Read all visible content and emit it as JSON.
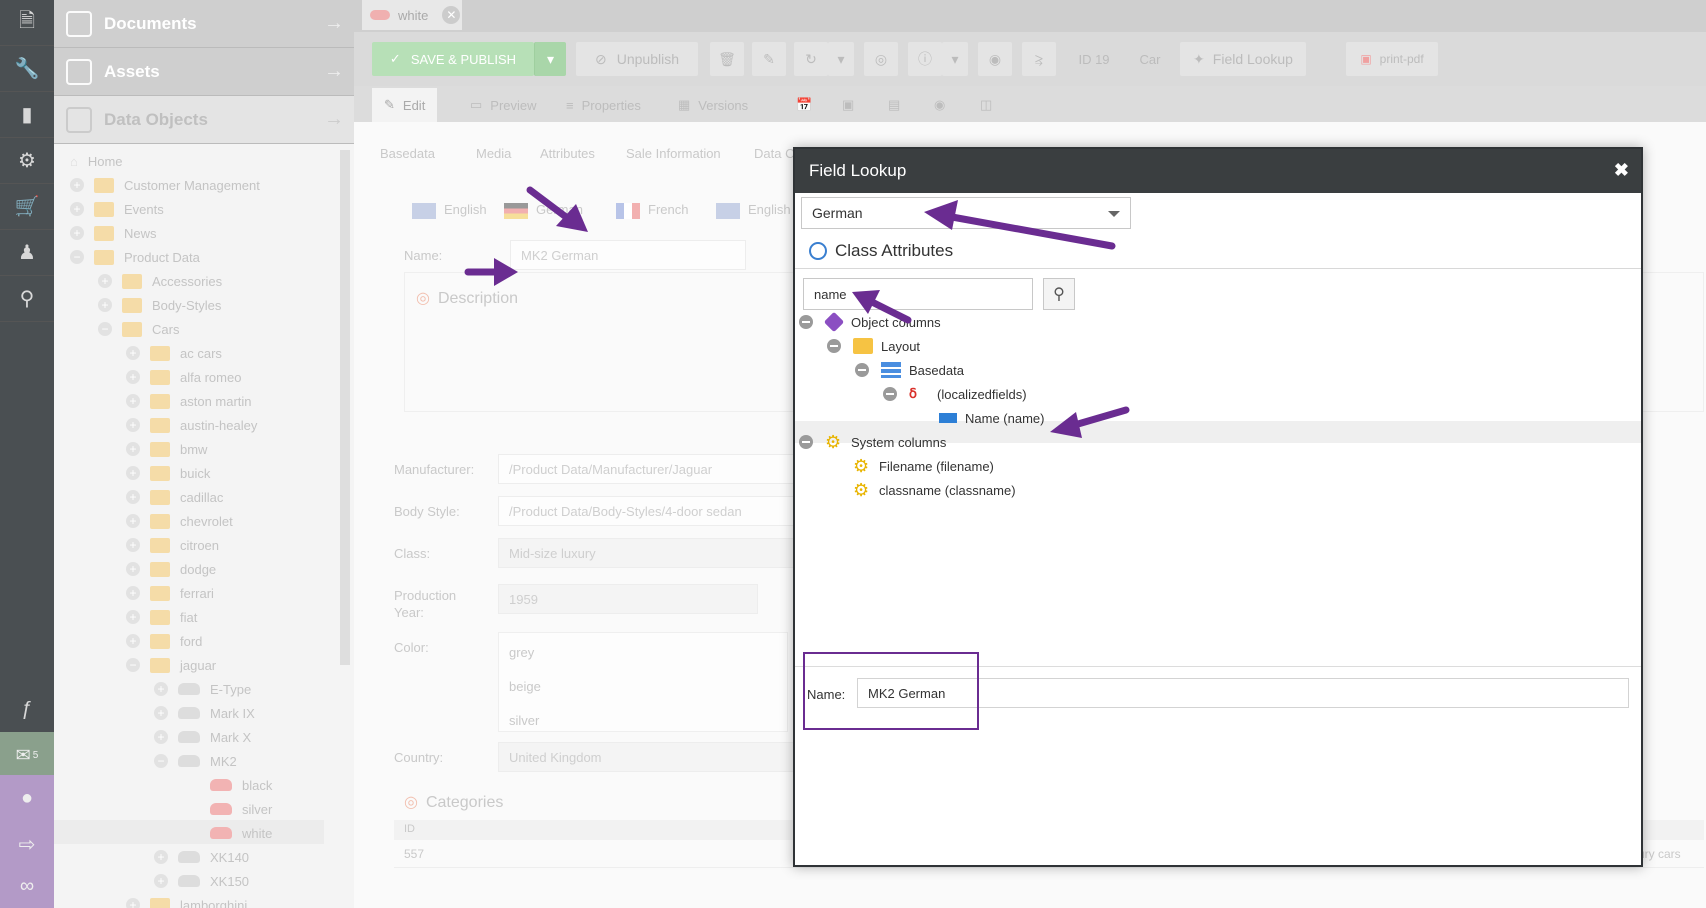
{
  "nav": {
    "accordion": [
      "Documents",
      "Assets",
      "Data Objects"
    ],
    "chat_count": "5"
  },
  "tree": {
    "root": "Home",
    "items": [
      "Customer Management",
      "Events",
      "News",
      "Product Data",
      "Accessories",
      "Body-Styles",
      "Cars",
      "ac cars",
      "alfa romeo",
      "aston martin",
      "austin-healey",
      "bmw",
      "buick",
      "cadillac",
      "chevrolet",
      "citroen",
      "dodge",
      "ferrari",
      "fiat",
      "ford",
      "jaguar",
      "E-Type",
      "Mark IX",
      "Mark X",
      "MK2",
      "black",
      "silver",
      "white",
      "XK140",
      "XK150",
      "lamborghini"
    ]
  },
  "tab": {
    "label": "white"
  },
  "toolbar": {
    "save": "SAVE & PUBLISH",
    "unpublish": "Unpublish",
    "id": "ID 19",
    "class": "Car",
    "field_lookup": "Field Lookup",
    "print": "print-pdf"
  },
  "subtabs": [
    "Edit",
    "Preview",
    "Properties",
    "Versions"
  ],
  "object": {
    "tabs": [
      "Basedata",
      "Media",
      "Attributes",
      "Sale Information",
      "Data C"
    ],
    "lang_tabs": [
      "English",
      "German",
      "French",
      "English"
    ],
    "name_label": "Name:",
    "name_value": "MK2 German",
    "description": "Description",
    "manufacturer_label": "Manufacturer:",
    "manufacturer": "/Product Data/Manufacturer/Jaguar",
    "body_style_label": "Body Style:",
    "body_style": "/Product Data/Body-Styles/4-door sedan",
    "class_label": "Class:",
    "class_value": "Mid-size luxury",
    "year_label_1": "Production",
    "year_label_2": "Year:",
    "year_value": "1959",
    "color_label": "Color:",
    "colors": [
      "grey",
      "beige",
      "silver"
    ],
    "country_label": "Country:",
    "country": "United Kingdom",
    "categories": "Categories",
    "cat_id_head": "ID",
    "cat_id": "557",
    "cat_tail": "ury cars"
  },
  "dialog": {
    "title": "Field Lookup",
    "language": "German",
    "section": "Class Attributes",
    "search": "name",
    "nodes": [
      "Object columns",
      "Layout",
      "Basedata",
      "(localizedfields)",
      "Name (name)",
      "System columns",
      "Filename (filename)",
      "classname (classname)"
    ],
    "result_label": "Name:",
    "result_value": "MK2 German"
  },
  "colors": {
    "annotation": "#6a2c91",
    "dialog_header": "#3a3e40"
  }
}
